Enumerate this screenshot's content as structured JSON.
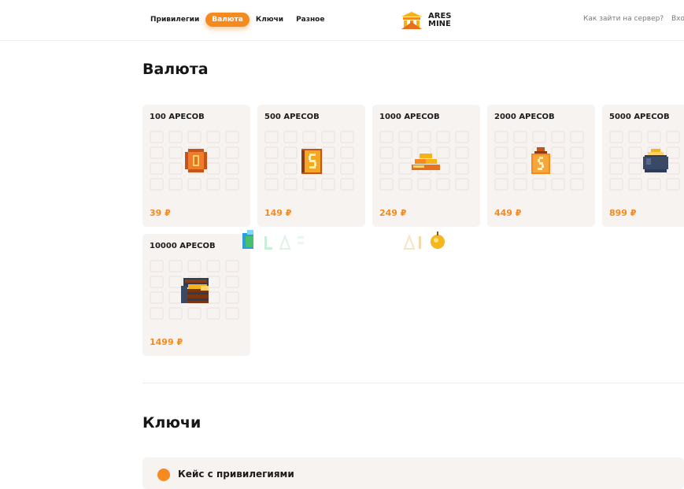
{
  "header": {
    "nav": [
      "Привилегии",
      "Валюта",
      "Ключи",
      "Разное"
    ],
    "active_nav": "Валюта",
    "logo_line1": "ARES",
    "logo_line2": "MINE",
    "help_link": "Как зайти на сервер?",
    "login_link": "Вхо"
  },
  "sections": {
    "currency_title": "Валюта",
    "keys_title": "Ключи"
  },
  "cards": [
    {
      "title": "100 АРЕСОВ",
      "price": "39 ₽",
      "icon": "coin-icon"
    },
    {
      "title": "500 АРЕСОВ",
      "price": "149 ₽",
      "icon": "gold-book-icon"
    },
    {
      "title": "1000 АРЕСОВ",
      "price": "249 ₽",
      "icon": "gold-bars-icon"
    },
    {
      "title": "2000 АРЕСОВ",
      "price": "449 ₽",
      "icon": "money-bag-icon"
    },
    {
      "title": "5000 АРЕСОВ",
      "price": "899 ₽",
      "icon": "pot-of-gold-icon"
    },
    {
      "title": "10000 АРЕСОВ",
      "price": "1499 ₽",
      "icon": "treasure-chest-icon"
    }
  ],
  "keys_item": {
    "label": "Кейс с привилегиями",
    "icon": "crown-icon"
  },
  "colors": {
    "accent": "#f58a1f",
    "card_bg": "#f7f3f1"
  }
}
